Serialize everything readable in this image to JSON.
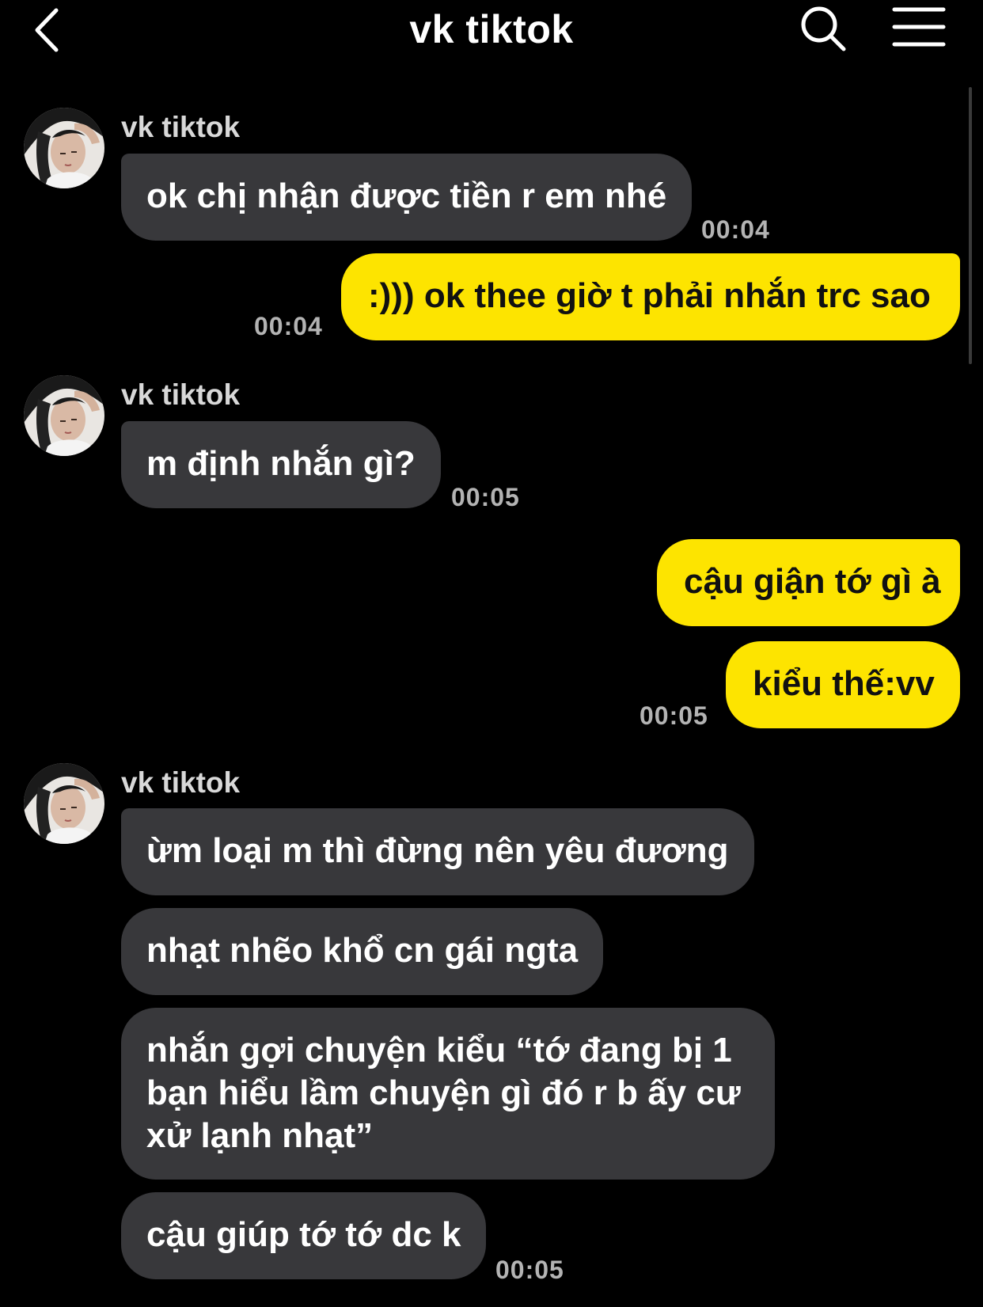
{
  "header": {
    "title": "vk tiktok",
    "back_icon": "chevron-left-icon",
    "search_icon": "search-icon",
    "menu_icon": "hamburger-menu-icon"
  },
  "colors": {
    "background": "#000000",
    "incoming_bubble": "#38383B",
    "outgoing_bubble": "#FDE400",
    "timestamp": "#B3B3B3"
  },
  "contact": {
    "name": "vk tiktok"
  },
  "messages": [
    {
      "direction": "in",
      "text": "ok chị nhận được tiền r em nhé",
      "time": "00:04"
    },
    {
      "direction": "out",
      "text": ":))) ok thee giờ t phải nhắn trc sao",
      "time": "00:04"
    },
    {
      "direction": "in",
      "text": "m định nhắn gì?",
      "time": "00:05"
    },
    {
      "direction": "out",
      "text": "cậu giận tớ gì à"
    },
    {
      "direction": "out",
      "text": "kiểu thế:vv",
      "time": "00:05"
    },
    {
      "direction": "in",
      "text": "ừm loại m thì đừng nên yêu đương"
    },
    {
      "direction": "in",
      "text": "nhạt nhẽo khổ cn gái ngta"
    },
    {
      "direction": "in",
      "text": "nhắn gợi chuyện kiểu “tớ đang bị 1 bạn hiểu lầm chuyện gì đó r b ấy cư xử lạnh nhạt”"
    },
    {
      "direction": "in",
      "text": "cậu giúp tớ tớ dc k",
      "time": "00:05"
    }
  ]
}
